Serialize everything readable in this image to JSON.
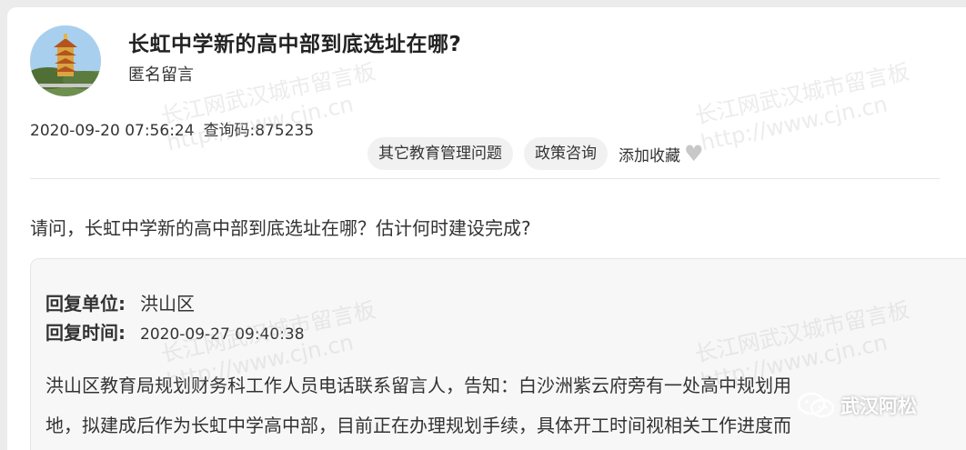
{
  "post": {
    "title": "长虹中学新的高中部到底选址在哪?",
    "author": "匿名留言",
    "datetime": "2020-09-20 07:56:24",
    "query_code_label": "查询码:",
    "query_code": "875235",
    "question": "请问，长虹中学新的高中部到底选址在哪？估计何时建设完成?"
  },
  "tags": [
    {
      "label": "其它教育管理问题"
    },
    {
      "label": "政策咨询"
    }
  ],
  "favorite": {
    "label": "添加收藏",
    "icon": "heart-icon"
  },
  "reply": {
    "unit_label": "回复单位:",
    "unit_value": "洪山区",
    "time_label": "回复时间:",
    "time_value": "2020-09-27 09:40:38",
    "lines": [
      "洪山区教育局规划财务科工作人员电话联系留言人，告知：白沙洲紫云府旁有一处高中规划用",
      "地，拟建成后作为长虹中学高中部，目前正在办理规划手续，具体开工时间视相关工作进度而"
    ]
  },
  "watermark": {
    "line1": "长江网武汉城市留言板",
    "line2": "http://www.cjn.cn"
  },
  "brand": {
    "name": "武汉阿松",
    "icon": "wechat-icon"
  },
  "colors": {
    "card": "#ffffff",
    "background": "#ececec",
    "tag_bg": "#f1f1f1",
    "reply_bg": "#f7f7f7",
    "heart": "#c8c8c8"
  }
}
